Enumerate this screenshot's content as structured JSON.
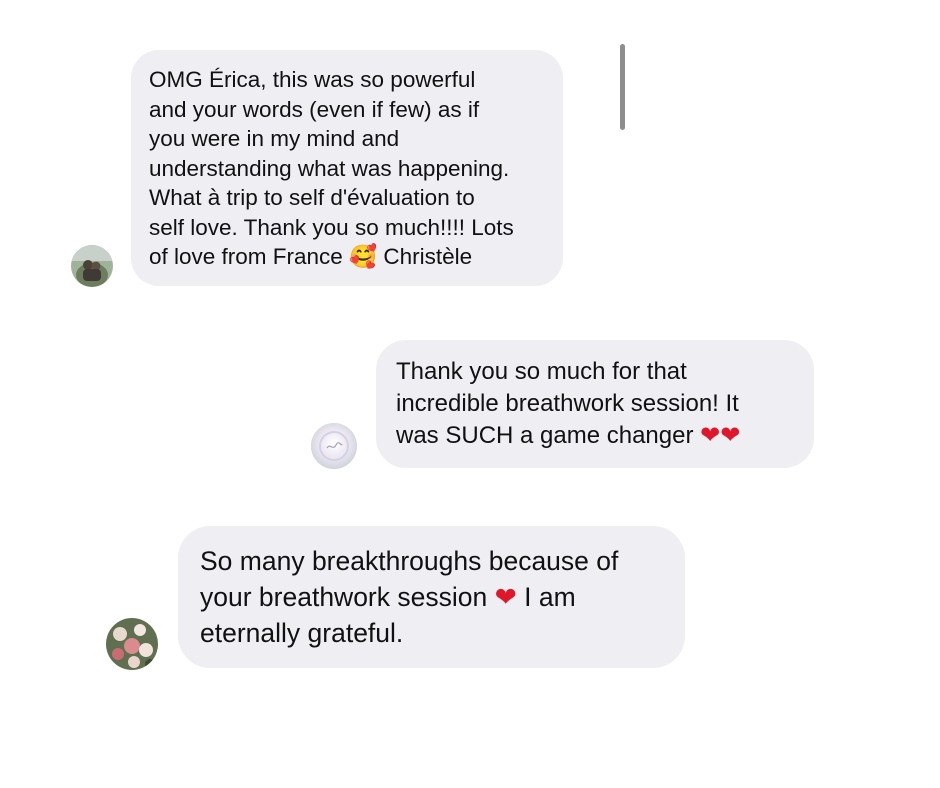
{
  "thread": {
    "messages": [
      {
        "text_before": "OMG Érica, this was so powerful\nand your words (even if few) as if\nyou were in my mind and\nunderstanding what was happening.\nWhat à trip to self d'évaluation to\nself love. Thank you so much!!!! Lots\nof love from France ",
        "emoji": "🥰",
        "text_after": " Christèle"
      },
      {
        "text_before": "Thank you so much for that\nincredible breathwork session! It\nwas SUCH a game changer ",
        "emoji": "❤❤",
        "text_after": ""
      },
      {
        "text_before": "So many breakthroughs because of\nyour breathwork session ",
        "emoji": "❤",
        "text_after": "  I am\neternally grateful."
      }
    ]
  },
  "colors": {
    "bubble_background": "#efeff3",
    "text": "#111111",
    "heart": "#e0172b",
    "scroll_indicator": "#8e8e8e"
  }
}
